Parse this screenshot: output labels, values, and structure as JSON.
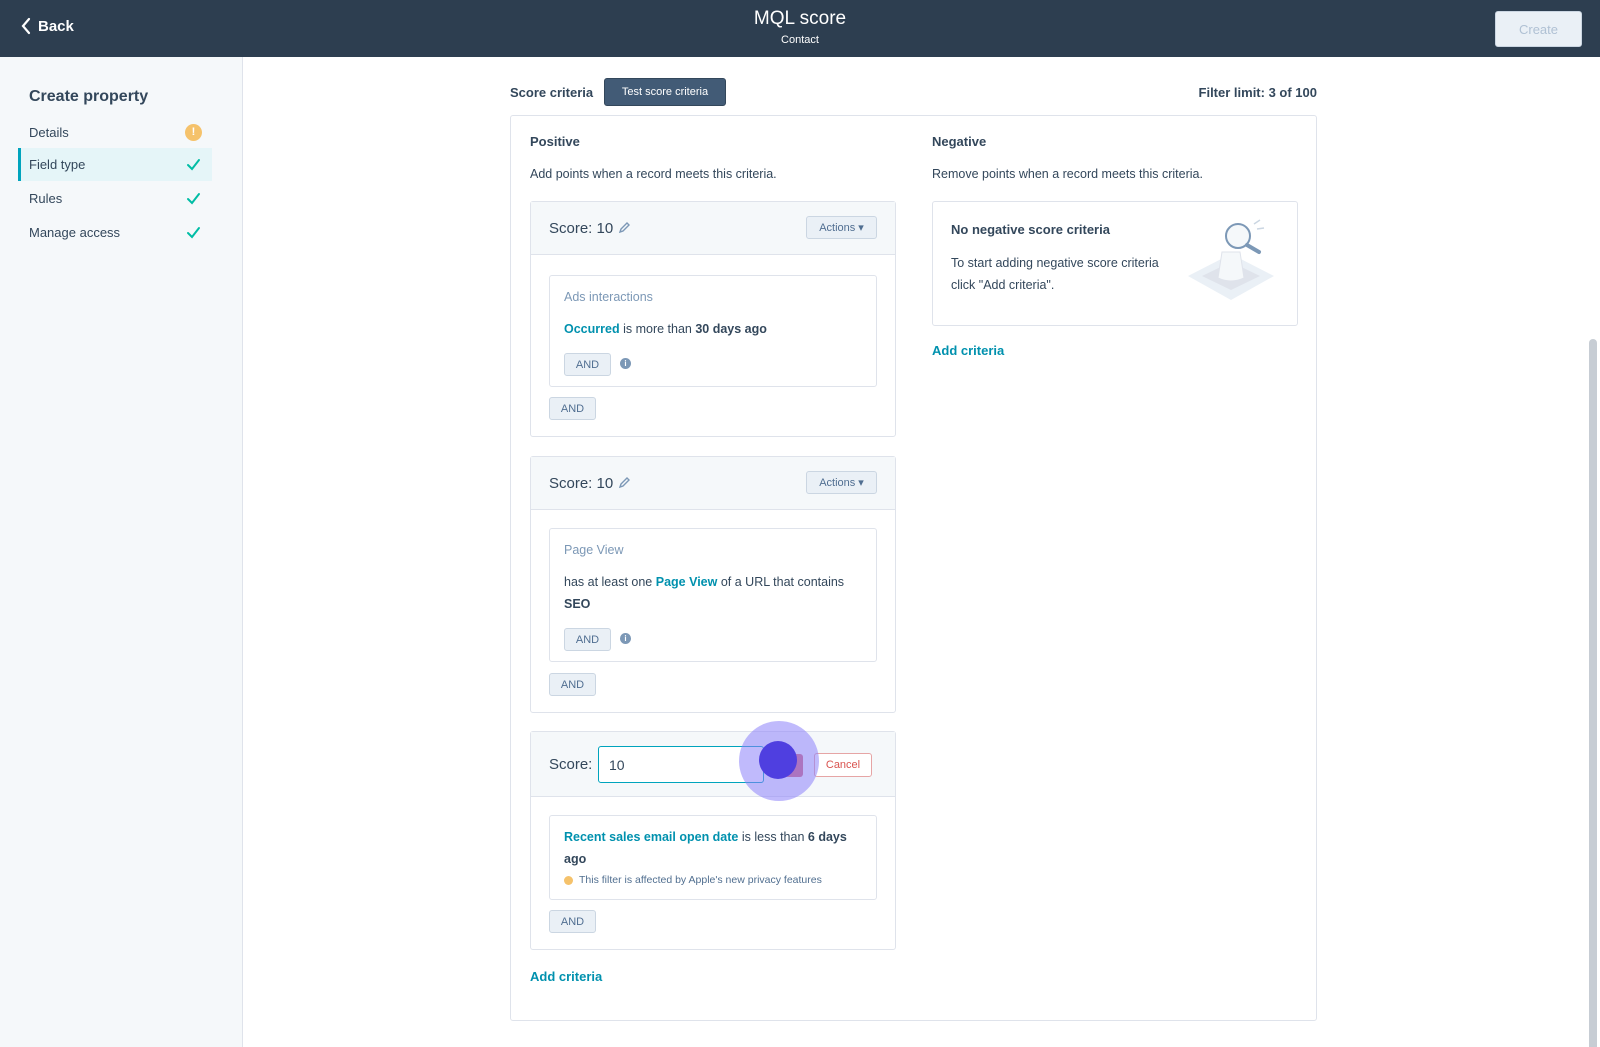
{
  "header": {
    "back_label": "Back",
    "title": "MQL score",
    "subtitle": "Contact",
    "create_label": "Create"
  },
  "sidebar": {
    "title": "Create property",
    "items": [
      {
        "label": "Details",
        "status": "warning"
      },
      {
        "label": "Field type",
        "status": "complete"
      },
      {
        "label": "Rules",
        "status": "complete"
      },
      {
        "label": "Manage access",
        "status": "complete"
      }
    ]
  },
  "criteria": {
    "label": "Score criteria",
    "test_button": "Test score criteria",
    "filter_limit": "Filter limit: 3 of 100"
  },
  "positive": {
    "title": "Positive",
    "description": "Add points when a record meets this criteria.",
    "add_criteria": "Add criteria",
    "groups": [
      {
        "score_label": "Score: 10",
        "actions_label": "Actions",
        "filter_type": "Ads interactions",
        "filter_link": "Occurred",
        "filter_text_1": "is more than",
        "filter_bold": "30 days ago",
        "and_inner": "AND",
        "and_outer": "AND"
      },
      {
        "score_label": "Score: 10",
        "actions_label": "Actions",
        "filter_type": "Page View",
        "filter_text_1": "has at least one",
        "filter_link": "Page View",
        "filter_text_2": "of a URL that contains",
        "filter_bold": "SEO",
        "and_inner": "AND",
        "and_outer": "AND"
      },
      {
        "score_label": "Score:",
        "score_value": "10",
        "cancel_label": "Cancel",
        "filter_link": "Recent sales email open date",
        "filter_text_1": "is less than",
        "filter_bold": "6 days ago",
        "privacy_note": "This filter is affected by Apple's new privacy features",
        "and_outer": "AND"
      }
    ]
  },
  "negative": {
    "title": "Negative",
    "description": "Remove points when a record meets this criteria.",
    "empty_title": "No negative score criteria",
    "empty_text": "To start adding negative score criteria click \"Add criteria\".",
    "add_criteria": "Add criteria"
  },
  "colors": {
    "header_bg": "#2d3e50",
    "accent": "#00a4bd",
    "link": "#0091ae",
    "success": "#00bda5",
    "warning": "#f5c26b"
  }
}
